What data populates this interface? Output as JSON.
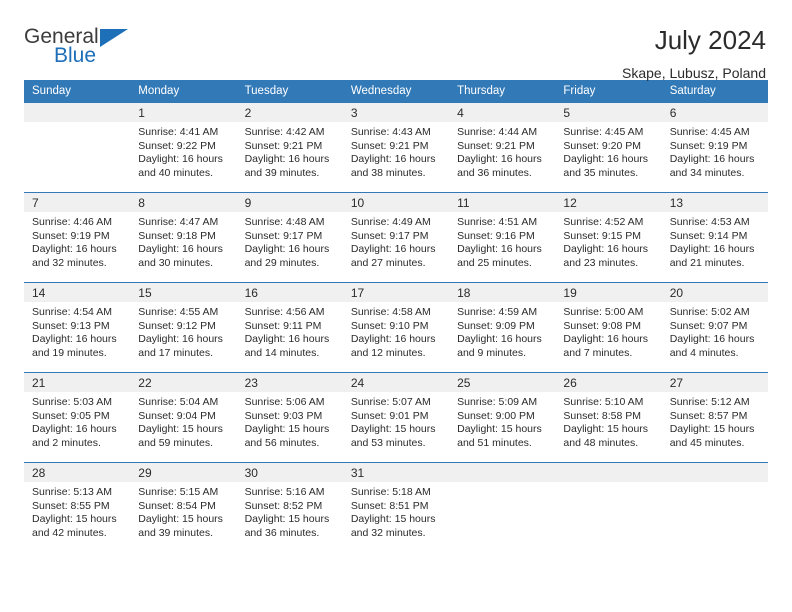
{
  "brand": {
    "name_part1": "General",
    "name_part2": "Blue",
    "accent_color": "#1d6fb8"
  },
  "header": {
    "title": "July 2024",
    "subtitle": "Skape, Lubusz, Poland"
  },
  "calendar": {
    "header_bg": "#3279b7",
    "daynum_bg": "#f0f0f0",
    "weekday_headers": [
      "Sunday",
      "Monday",
      "Tuesday",
      "Wednesday",
      "Thursday",
      "Friday",
      "Saturday"
    ],
    "weeks": [
      [
        {
          "day": "",
          "sunrise": "",
          "sunset": "",
          "daylight_line1": "",
          "daylight_line2": ""
        },
        {
          "day": "1",
          "sunrise": "Sunrise: 4:41 AM",
          "sunset": "Sunset: 9:22 PM",
          "daylight_line1": "Daylight: 16 hours",
          "daylight_line2": "and 40 minutes."
        },
        {
          "day": "2",
          "sunrise": "Sunrise: 4:42 AM",
          "sunset": "Sunset: 9:21 PM",
          "daylight_line1": "Daylight: 16 hours",
          "daylight_line2": "and 39 minutes."
        },
        {
          "day": "3",
          "sunrise": "Sunrise: 4:43 AM",
          "sunset": "Sunset: 9:21 PM",
          "daylight_line1": "Daylight: 16 hours",
          "daylight_line2": "and 38 minutes."
        },
        {
          "day": "4",
          "sunrise": "Sunrise: 4:44 AM",
          "sunset": "Sunset: 9:21 PM",
          "daylight_line1": "Daylight: 16 hours",
          "daylight_line2": "and 36 minutes."
        },
        {
          "day": "5",
          "sunrise": "Sunrise: 4:45 AM",
          "sunset": "Sunset: 9:20 PM",
          "daylight_line1": "Daylight: 16 hours",
          "daylight_line2": "and 35 minutes."
        },
        {
          "day": "6",
          "sunrise": "Sunrise: 4:45 AM",
          "sunset": "Sunset: 9:19 PM",
          "daylight_line1": "Daylight: 16 hours",
          "daylight_line2": "and 34 minutes."
        }
      ],
      [
        {
          "day": "7",
          "sunrise": "Sunrise: 4:46 AM",
          "sunset": "Sunset: 9:19 PM",
          "daylight_line1": "Daylight: 16 hours",
          "daylight_line2": "and 32 minutes."
        },
        {
          "day": "8",
          "sunrise": "Sunrise: 4:47 AM",
          "sunset": "Sunset: 9:18 PM",
          "daylight_line1": "Daylight: 16 hours",
          "daylight_line2": "and 30 minutes."
        },
        {
          "day": "9",
          "sunrise": "Sunrise: 4:48 AM",
          "sunset": "Sunset: 9:17 PM",
          "daylight_line1": "Daylight: 16 hours",
          "daylight_line2": "and 29 minutes."
        },
        {
          "day": "10",
          "sunrise": "Sunrise: 4:49 AM",
          "sunset": "Sunset: 9:17 PM",
          "daylight_line1": "Daylight: 16 hours",
          "daylight_line2": "and 27 minutes."
        },
        {
          "day": "11",
          "sunrise": "Sunrise: 4:51 AM",
          "sunset": "Sunset: 9:16 PM",
          "daylight_line1": "Daylight: 16 hours",
          "daylight_line2": "and 25 minutes."
        },
        {
          "day": "12",
          "sunrise": "Sunrise: 4:52 AM",
          "sunset": "Sunset: 9:15 PM",
          "daylight_line1": "Daylight: 16 hours",
          "daylight_line2": "and 23 minutes."
        },
        {
          "day": "13",
          "sunrise": "Sunrise: 4:53 AM",
          "sunset": "Sunset: 9:14 PM",
          "daylight_line1": "Daylight: 16 hours",
          "daylight_line2": "and 21 minutes."
        }
      ],
      [
        {
          "day": "14",
          "sunrise": "Sunrise: 4:54 AM",
          "sunset": "Sunset: 9:13 PM",
          "daylight_line1": "Daylight: 16 hours",
          "daylight_line2": "and 19 minutes."
        },
        {
          "day": "15",
          "sunrise": "Sunrise: 4:55 AM",
          "sunset": "Sunset: 9:12 PM",
          "daylight_line1": "Daylight: 16 hours",
          "daylight_line2": "and 17 minutes."
        },
        {
          "day": "16",
          "sunrise": "Sunrise: 4:56 AM",
          "sunset": "Sunset: 9:11 PM",
          "daylight_line1": "Daylight: 16 hours",
          "daylight_line2": "and 14 minutes."
        },
        {
          "day": "17",
          "sunrise": "Sunrise: 4:58 AM",
          "sunset": "Sunset: 9:10 PM",
          "daylight_line1": "Daylight: 16 hours",
          "daylight_line2": "and 12 minutes."
        },
        {
          "day": "18",
          "sunrise": "Sunrise: 4:59 AM",
          "sunset": "Sunset: 9:09 PM",
          "daylight_line1": "Daylight: 16 hours",
          "daylight_line2": "and 9 minutes."
        },
        {
          "day": "19",
          "sunrise": "Sunrise: 5:00 AM",
          "sunset": "Sunset: 9:08 PM",
          "daylight_line1": "Daylight: 16 hours",
          "daylight_line2": "and 7 minutes."
        },
        {
          "day": "20",
          "sunrise": "Sunrise: 5:02 AM",
          "sunset": "Sunset: 9:07 PM",
          "daylight_line1": "Daylight: 16 hours",
          "daylight_line2": "and 4 minutes."
        }
      ],
      [
        {
          "day": "21",
          "sunrise": "Sunrise: 5:03 AM",
          "sunset": "Sunset: 9:05 PM",
          "daylight_line1": "Daylight: 16 hours",
          "daylight_line2": "and 2 minutes."
        },
        {
          "day": "22",
          "sunrise": "Sunrise: 5:04 AM",
          "sunset": "Sunset: 9:04 PM",
          "daylight_line1": "Daylight: 15 hours",
          "daylight_line2": "and 59 minutes."
        },
        {
          "day": "23",
          "sunrise": "Sunrise: 5:06 AM",
          "sunset": "Sunset: 9:03 PM",
          "daylight_line1": "Daylight: 15 hours",
          "daylight_line2": "and 56 minutes."
        },
        {
          "day": "24",
          "sunrise": "Sunrise: 5:07 AM",
          "sunset": "Sunset: 9:01 PM",
          "daylight_line1": "Daylight: 15 hours",
          "daylight_line2": "and 53 minutes."
        },
        {
          "day": "25",
          "sunrise": "Sunrise: 5:09 AM",
          "sunset": "Sunset: 9:00 PM",
          "daylight_line1": "Daylight: 15 hours",
          "daylight_line2": "and 51 minutes."
        },
        {
          "day": "26",
          "sunrise": "Sunrise: 5:10 AM",
          "sunset": "Sunset: 8:58 PM",
          "daylight_line1": "Daylight: 15 hours",
          "daylight_line2": "and 48 minutes."
        },
        {
          "day": "27",
          "sunrise": "Sunrise: 5:12 AM",
          "sunset": "Sunset: 8:57 PM",
          "daylight_line1": "Daylight: 15 hours",
          "daylight_line2": "and 45 minutes."
        }
      ],
      [
        {
          "day": "28",
          "sunrise": "Sunrise: 5:13 AM",
          "sunset": "Sunset: 8:55 PM",
          "daylight_line1": "Daylight: 15 hours",
          "daylight_line2": "and 42 minutes."
        },
        {
          "day": "29",
          "sunrise": "Sunrise: 5:15 AM",
          "sunset": "Sunset: 8:54 PM",
          "daylight_line1": "Daylight: 15 hours",
          "daylight_line2": "and 39 minutes."
        },
        {
          "day": "30",
          "sunrise": "Sunrise: 5:16 AM",
          "sunset": "Sunset: 8:52 PM",
          "daylight_line1": "Daylight: 15 hours",
          "daylight_line2": "and 36 minutes."
        },
        {
          "day": "31",
          "sunrise": "Sunrise: 5:18 AM",
          "sunset": "Sunset: 8:51 PM",
          "daylight_line1": "Daylight: 15 hours",
          "daylight_line2": "and 32 minutes."
        },
        {
          "day": "",
          "sunrise": "",
          "sunset": "",
          "daylight_line1": "",
          "daylight_line2": ""
        },
        {
          "day": "",
          "sunrise": "",
          "sunset": "",
          "daylight_line1": "",
          "daylight_line2": ""
        },
        {
          "day": "",
          "sunrise": "",
          "sunset": "",
          "daylight_line1": "",
          "daylight_line2": ""
        }
      ]
    ]
  }
}
